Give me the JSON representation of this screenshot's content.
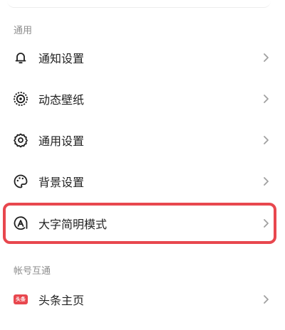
{
  "colors": {
    "accent": "#e8474e",
    "text": "#222222",
    "section": "#8c8c8c",
    "icon": "#1f1f1f",
    "chevron": "#a0a0a0",
    "badge": "#e8474e"
  },
  "sections": [
    {
      "title": "通用"
    },
    {
      "title": "帐号互通"
    }
  ],
  "general_items": [
    {
      "label": "通知设置",
      "icon": "bell-icon"
    },
    {
      "label": "动态壁纸",
      "icon": "live-wallpaper-icon"
    },
    {
      "label": "通用设置",
      "icon": "gear-icon"
    },
    {
      "label": "背景设置",
      "icon": "palette-icon"
    },
    {
      "label": "大字简明模式",
      "icon": "large-font-icon",
      "highlighted": true
    }
  ],
  "account_items": [
    {
      "label": "头条主页",
      "icon": "toutiao-badge-icon",
      "badge_text": "头条"
    }
  ]
}
